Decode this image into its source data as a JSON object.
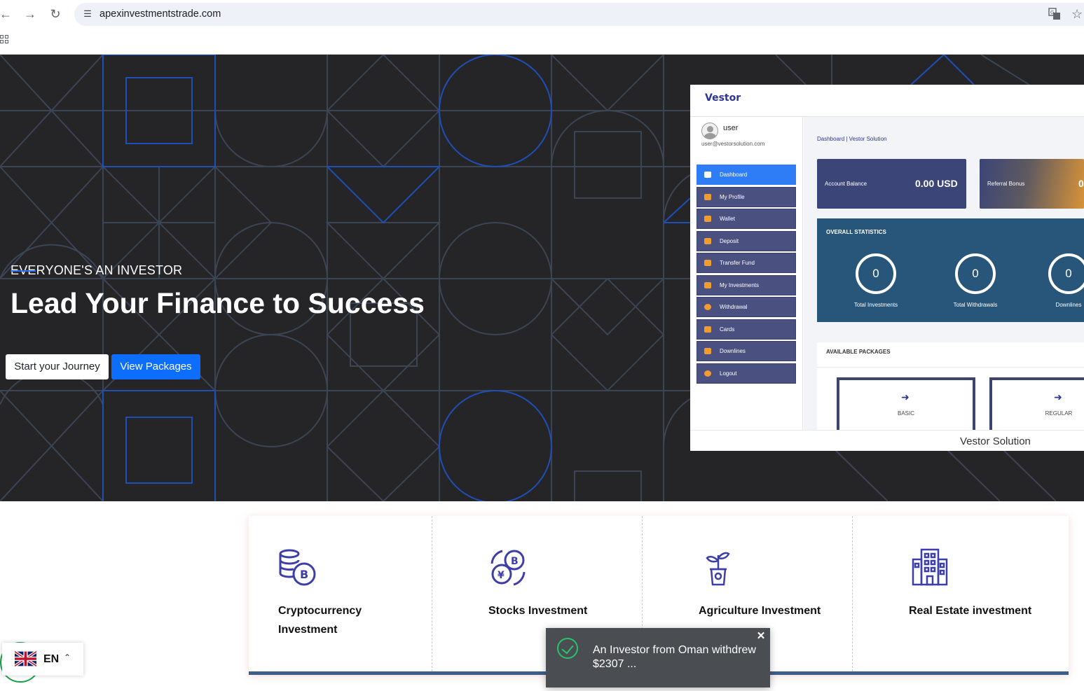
{
  "browser": {
    "url": "apexinvestmentstrade.com",
    "icons": {
      "back": "back-arrow-icon",
      "forward": "forward-arrow-icon",
      "reload": "reload-icon",
      "site_settings": "tune-icon",
      "translate": "translate-icon",
      "bookmark": "star-icon",
      "apps": "apps-grid-icon"
    }
  },
  "hero": {
    "eyebrow": "EVERYONE'S AN INVESTOR",
    "title": "Lead Your Finance to Success",
    "start_button": "Start your Journey",
    "packages_button": "View Packages",
    "background_color": "#252427",
    "accent_color": "#2a6cf6"
  },
  "preview": {
    "logo": "Vestor",
    "user_name": "user",
    "user_email": "user@vestorsolution.com",
    "menu": [
      {
        "label": "Dashboard",
        "active": true
      },
      {
        "label": "My Profile",
        "active": false
      },
      {
        "label": "Wallet",
        "active": false
      },
      {
        "label": "Deposit",
        "active": false
      },
      {
        "label": "Transfer Fund",
        "active": false
      },
      {
        "label": "My Investments",
        "active": false
      },
      {
        "label": "Withdrawal",
        "active": false
      },
      {
        "label": "Cards",
        "active": false
      },
      {
        "label": "Downlines",
        "active": false
      },
      {
        "label": "Logout",
        "active": false
      }
    ],
    "breadcrumb": "Dashboard | Vestor Solution",
    "cards": [
      {
        "label": "Account Balance",
        "value": "0.00 USD"
      },
      {
        "label": "Referral Bonus",
        "value": "0"
      }
    ],
    "stats_title": "OVERALL STATISTICS",
    "stats": [
      {
        "label": "Total Investments",
        "value": "0"
      },
      {
        "label": "Total Withdrawals",
        "value": "0"
      },
      {
        "label": "Downlines",
        "value": "0"
      }
    ],
    "packages_title": "AVAILABLE PACKAGES",
    "packages": [
      {
        "label": "BASIC"
      },
      {
        "label": "REGULAR"
      }
    ],
    "footer": "Vestor Solution"
  },
  "features": [
    {
      "title": "Cryptocurrency Investment",
      "icon": "crypto-coins-icon"
    },
    {
      "title": "Stocks Investment",
      "icon": "currency-exchange-icon"
    },
    {
      "title": "Agriculture Investment",
      "icon": "plant-pot-icon"
    },
    {
      "title": "Real Estate investment",
      "icon": "building-icon"
    }
  ],
  "language": {
    "code": "EN"
  },
  "toast": {
    "text": "An Investor from Oman withdrew $2307 ..."
  }
}
